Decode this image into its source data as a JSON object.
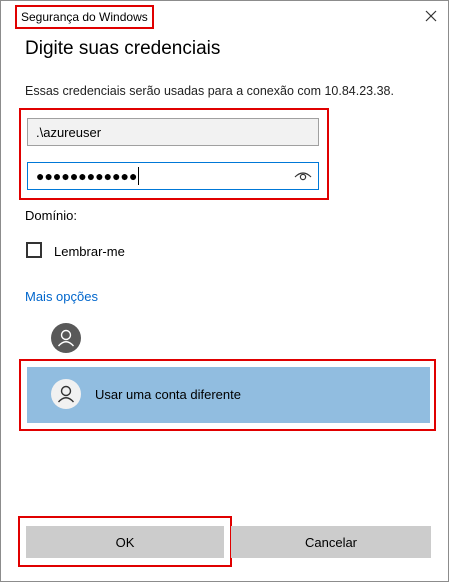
{
  "window": {
    "title": "Segurança do Windows"
  },
  "dialog": {
    "heading": "Digite suas credenciais",
    "info": "Essas credenciais serão usadas para a conexão com 10.84.23.38.",
    "username_value": ".\\azureuser",
    "password_mask": "●●●●●●●●●●●●",
    "domain_label": "Domínio:",
    "remember_label": "Lembrar-me",
    "remember_checked": false,
    "more_options": "Mais opções",
    "alt_account_label": "Usar uma conta diferente"
  },
  "buttons": {
    "ok": "OK",
    "cancel": "Cancelar"
  },
  "colors": {
    "highlight_border": "#e00000",
    "link": "#0066cc",
    "selected_item": "#91bde0",
    "focus_border": "#0078d7"
  },
  "icons": {
    "close": "close-icon",
    "reveal_password": "eye-icon",
    "user": "user-icon"
  }
}
